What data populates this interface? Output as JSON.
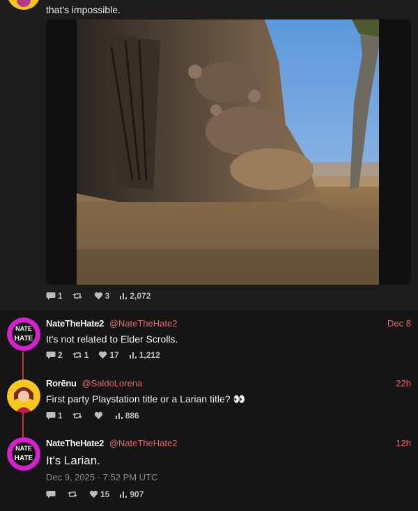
{
  "posts": [
    {
      "text_tail": "that's impossible.",
      "stats": {
        "replies": "1",
        "reposts": "",
        "likes": "3",
        "views": "2,072"
      }
    },
    {
      "author": "NateTheHate2",
      "handle": "@NateTheHate2",
      "time": "Dec 8",
      "text": "It's not related to Elder Scrolls.",
      "stats": {
        "replies": "2",
        "reposts": "1",
        "likes": "17",
        "views": "1,212"
      }
    },
    {
      "author": "Rorēnu",
      "handle": "@SaldoLorena",
      "time": "22h",
      "text": "First party Playstation title or a Larian title? 👀",
      "stats": {
        "replies": "1",
        "reposts": "",
        "likes": "",
        "views": "886"
      }
    },
    {
      "author": "NateTheHate2",
      "handle": "@NateTheHate2",
      "time": "12h",
      "text": "It's Larian.",
      "date": "Dec 9, 2025 · 7:52 PM UTC",
      "stats": {
        "replies": "",
        "reposts": "",
        "likes": "15",
        "views": "907"
      }
    }
  ],
  "avatars": {
    "nate": {
      "text": "NATE THE HATE",
      "color": "#e21fd3"
    }
  },
  "colors": {
    "accent": "#e06b6b",
    "thread": "#c0392b"
  }
}
